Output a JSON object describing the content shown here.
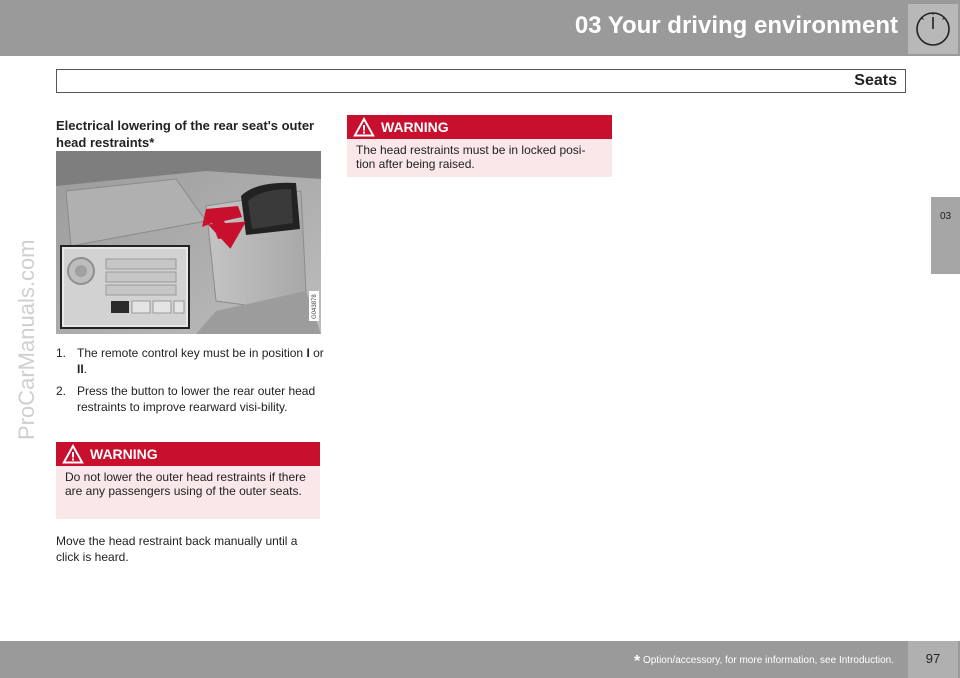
{
  "header": {
    "chapter_title": "03 Your driving environment",
    "section_title": "Seats",
    "side_tab": "03"
  },
  "watermark": "ProCarManuals.com",
  "content": {
    "sub_heading": "Electrical lowering of the rear seat's outer head restraints*",
    "figure_code": "G043878",
    "steps": [
      {
        "num": "1.",
        "text_before": "The remote control key must be in position ",
        "bold1": "I",
        "mid": " or ",
        "bold2": "II",
        "text_after": "."
      },
      {
        "num": "2.",
        "text": "Press the button to lower the rear outer head restraints to improve rearward visi-bility."
      }
    ],
    "warning1": {
      "label": "WARNING",
      "text": "Do not lower the outer head restraints if there are any passengers using of the outer seats."
    },
    "paragraph": "Move the head restraint back manually until a click is heard.",
    "warning2": {
      "label": "WARNING",
      "text": "The head restraints must be in locked posi-tion after being raised."
    }
  },
  "footer": {
    "star": "*",
    "footnote": "Option/accessory, for more information, see Introduction.",
    "page_number": "97"
  },
  "colors": {
    "header_gray": "#9a9a9b",
    "warning_red": "#c8102e",
    "warning_bg": "#f9e7ea"
  }
}
